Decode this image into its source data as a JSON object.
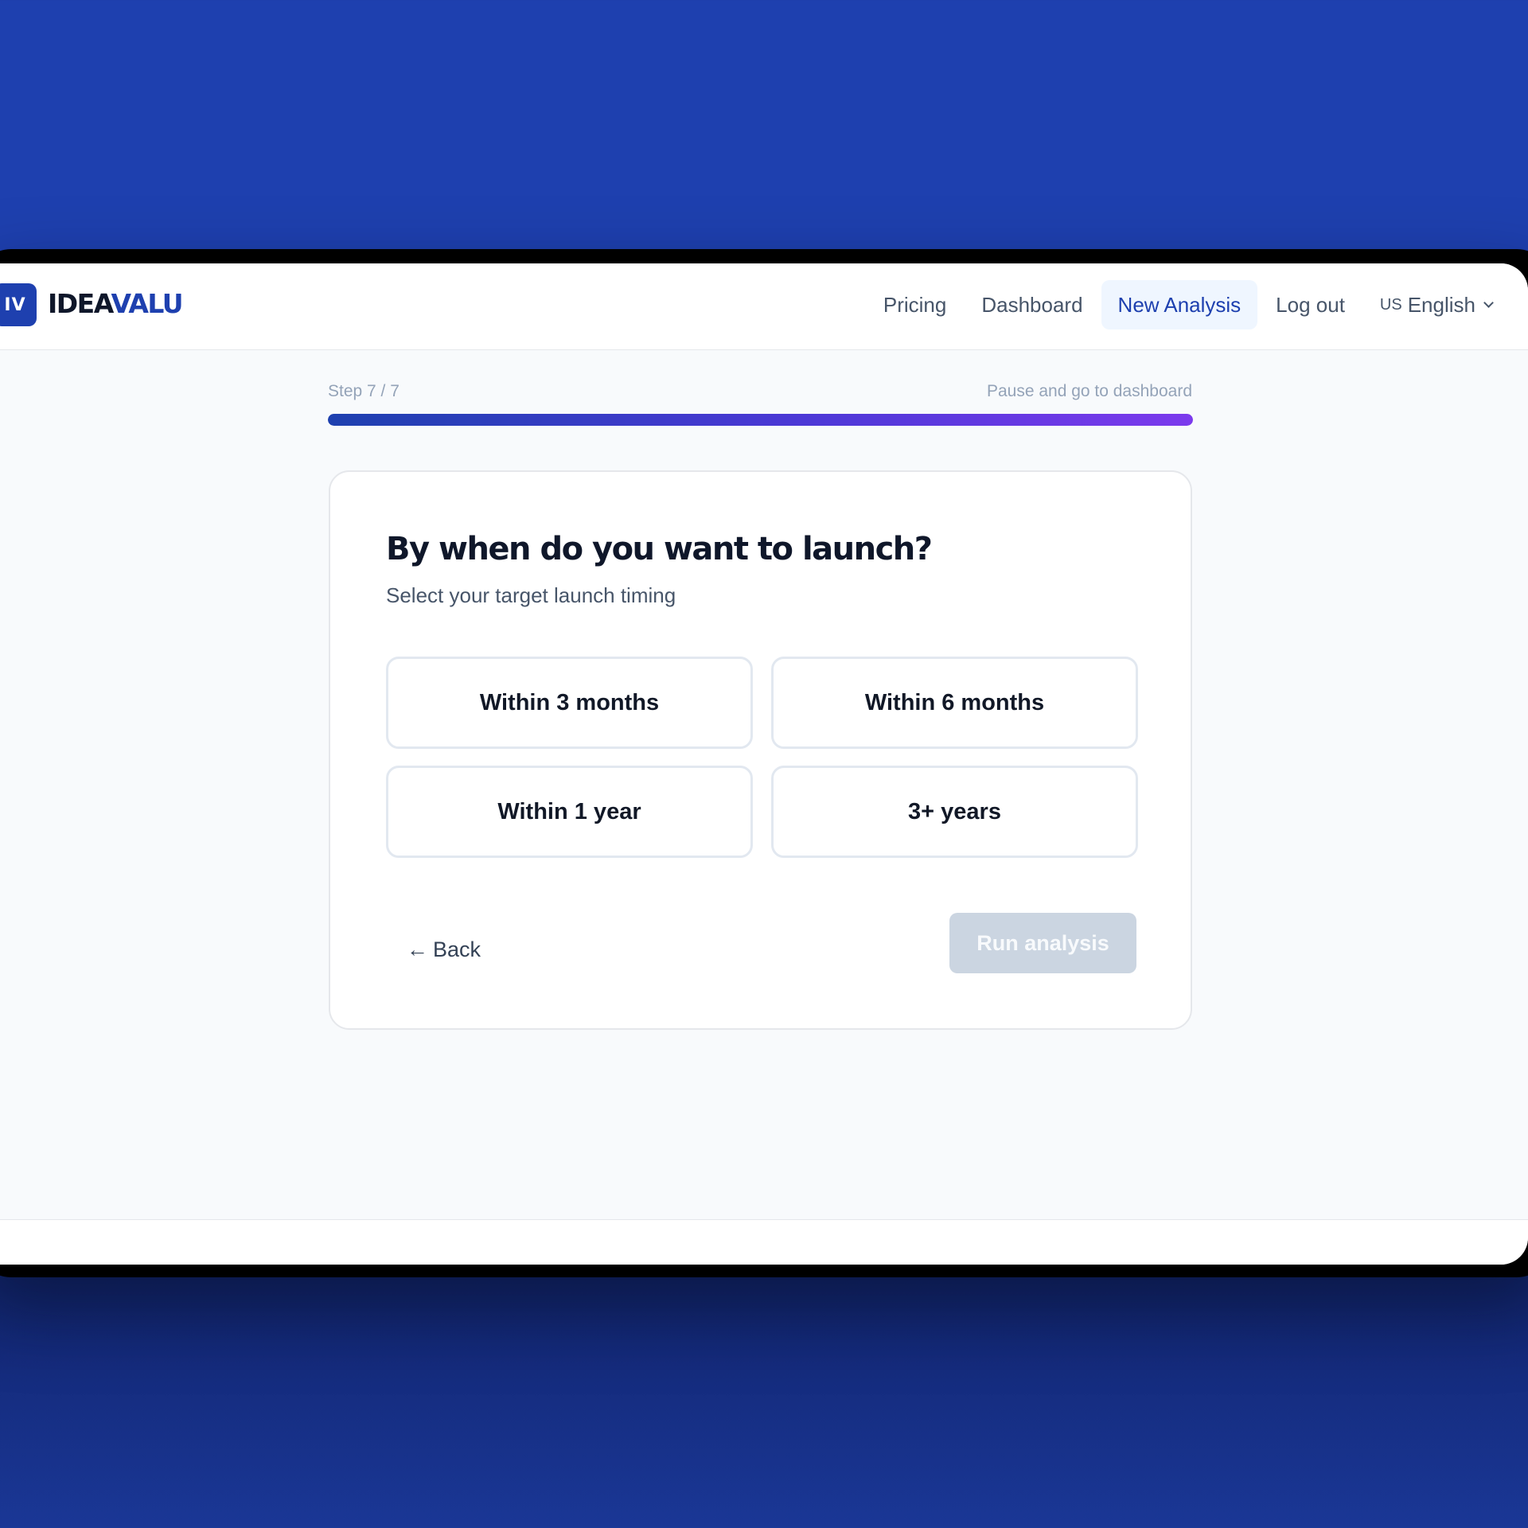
{
  "brand": {
    "mark": "IV",
    "name_part1": "IDEA",
    "name_part2": "VALU",
    "accent_color": "#1e40af"
  },
  "nav": {
    "items": [
      {
        "label": "Pricing",
        "active": false
      },
      {
        "label": "Dashboard",
        "active": false
      },
      {
        "label": "New Analysis",
        "active": true
      },
      {
        "label": "Log out",
        "active": false
      }
    ],
    "language": {
      "flag": "US",
      "label": "English",
      "icon": "chevron-down-icon"
    }
  },
  "wizard": {
    "step_label": "Step 7 / 7",
    "pause_label": "Pause and go to dashboard",
    "progress_fraction": 1.0,
    "progress_gradient": [
      "#1e40af",
      "#7c3aed"
    ]
  },
  "question": {
    "title": "By when do you want to launch?",
    "subtitle": "Select your target launch timing",
    "options": [
      {
        "label": "Within 3 months"
      },
      {
        "label": "Within 6 months"
      },
      {
        "label": "Within 1 year"
      },
      {
        "label": "3+ years"
      }
    ]
  },
  "actions": {
    "back_arrow": "←",
    "back_label": "Back",
    "run_label": "Run analysis",
    "run_disabled": true,
    "run_disabled_color": "#cbd5e1"
  }
}
